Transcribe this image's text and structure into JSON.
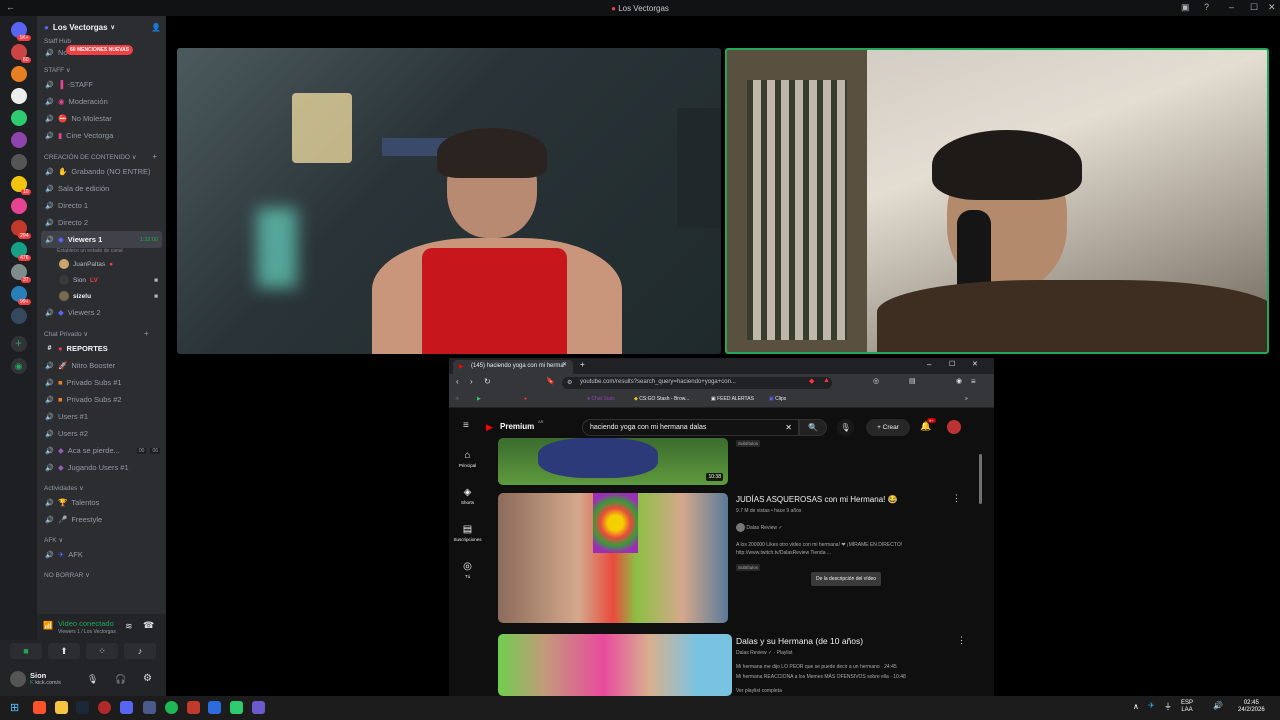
{
  "window": {
    "title": "Los Vectorgas"
  },
  "servers": {
    "badges": [
      "1K+",
      "60",
      "",
      "",
      "",
      "",
      "",
      "10",
      "",
      "294",
      "476",
      "37",
      "99+",
      "",
      "",
      ""
    ]
  },
  "discord": {
    "guild_name": "Los Vectorgas",
    "mentions_badge": "60 MENCIONES NUEVAS",
    "top_channel": "No Molestar Hawks",
    "staff_header": "Staff Hub",
    "categories": {
      "staff": "STAFF",
      "creacion": "CREACIÓN DE CONTENIDO",
      "chat_privado": "Chat Privado",
      "actividades": "Actividades",
      "afk": "AFK",
      "no_borrar": "NO BORRAR"
    },
    "staff_channels": [
      "-STAFF",
      "Moderación",
      "No Molestar",
      "Cine Vectorga"
    ],
    "creacion_channels": [
      "Grabando (NO ENTRE)",
      "Sala de edición",
      "Directo 1",
      "Directo 2"
    ],
    "active_channel": {
      "name": "Viewers 1",
      "timer": "1:32:00",
      "status": "Establece un estado de canal"
    },
    "members": [
      {
        "name": "JuanPaltas"
      },
      {
        "name": "Sion",
        "tag": "LV"
      },
      {
        "name": "sizelu"
      }
    ],
    "after_active": "Viewers 2",
    "private_channels": [
      "REPORTES",
      "Nitro Booster",
      "Privado Subs #1",
      "Privado Subs #2",
      "Users #1",
      "Users #2",
      "Aca se pierde...",
      "Jugando Users #1"
    ],
    "aca_counts": [
      "00",
      "06"
    ],
    "activity_channels": [
      "Talentos",
      "Freestyle"
    ],
    "afk_channels": [
      "AFK"
    ],
    "no_borrar_channel": "sinn_test",
    "voice": {
      "status": "Video conectado",
      "location": "Viewers 1 / Los Vectorgas"
    },
    "user": {
      "name": "Sion",
      "status": "kick.com/s"
    }
  },
  "browser": {
    "tab_title": "(145) haciendo yoga con mi herma",
    "url": "youtube.com/results?search_query=haciendo+yoga+con...",
    "bookmarks": [
      "Chat Stats",
      "CS:GO Stash - Brow...",
      "FEED ALERTAS",
      "Clips"
    ]
  },
  "youtube": {
    "logo": "Premium",
    "region": "AR",
    "search_value": "haciendo yoga con mi hermana dalas",
    "create_label": "Crear",
    "notif_count": "9+",
    "sidebar": [
      "Principal",
      "Shorts",
      "Suscripciones",
      "Tú"
    ],
    "top_chip": "Subtítulos",
    "video0_duration": "10:38",
    "video1": {
      "title": "JUDÍAS ASQUEROSAS con mi Hermana! 😂",
      "meta": "9.7 M de vistas • hace 9 años",
      "channel": "Dalas Review",
      "desc1": "A los 200000 Likes otro video con mi hermana! ❤ ¡MÍRAME EN DIRECTO!",
      "desc2": "http://www.twitch.tv/DalasReview Tienda ...",
      "chip": "Subtítulos",
      "tooltip": "De la descripción del vídeo"
    },
    "playlist": {
      "title": "Dalas y su Hermana (de 10 años)",
      "channel": "Dalas Review",
      "kind": "Playlist",
      "item1": "Mi hermana me dijo LO PEOR que se puede decir a un hermano · 24:45",
      "item2": "Mi hermana REACCIONA a los Memes MÁS OFENSIVOS sobre ella · 10:48",
      "view_all": "Ver playlist completa"
    }
  },
  "taskbar": {
    "lang1": "ESP",
    "lang2": "LAA",
    "time": "02:45",
    "date": "24/2/2026"
  }
}
